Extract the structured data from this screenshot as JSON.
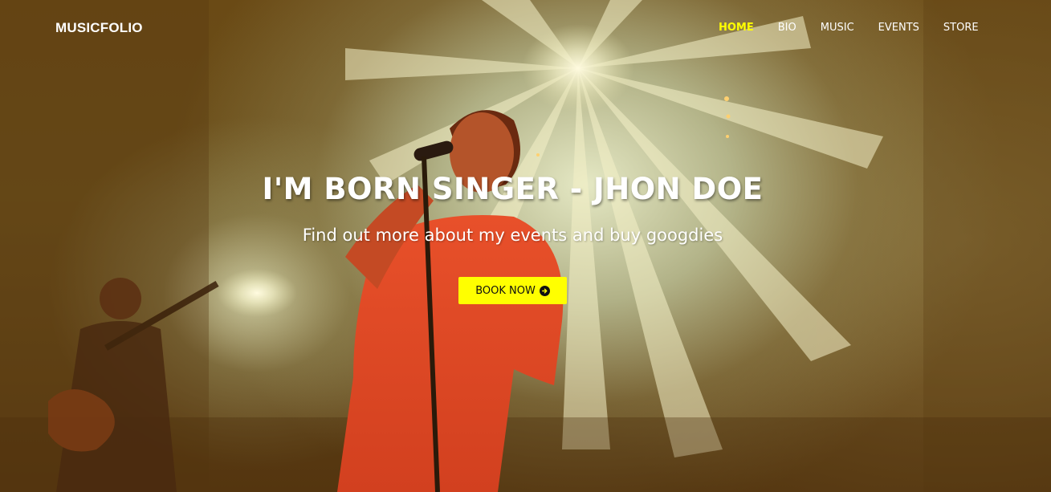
{
  "brand": "MUSICFOLIO",
  "nav": {
    "items": [
      {
        "label": "HOME",
        "active": true
      },
      {
        "label": "BIO",
        "active": false
      },
      {
        "label": "MUSIC",
        "active": false
      },
      {
        "label": "EVENTS",
        "active": false
      },
      {
        "label": "STORE",
        "active": false
      }
    ]
  },
  "hero": {
    "title": "I'M BORN SINGER - JHON DOE",
    "subtitle": "Find out more about my events and buy googdies",
    "cta_label": "BOOK NOW",
    "cta_icon": "circle-arrow-right-icon"
  },
  "colors": {
    "accent": "#ffff00",
    "text": "#ffffff",
    "button_text": "#111111"
  }
}
